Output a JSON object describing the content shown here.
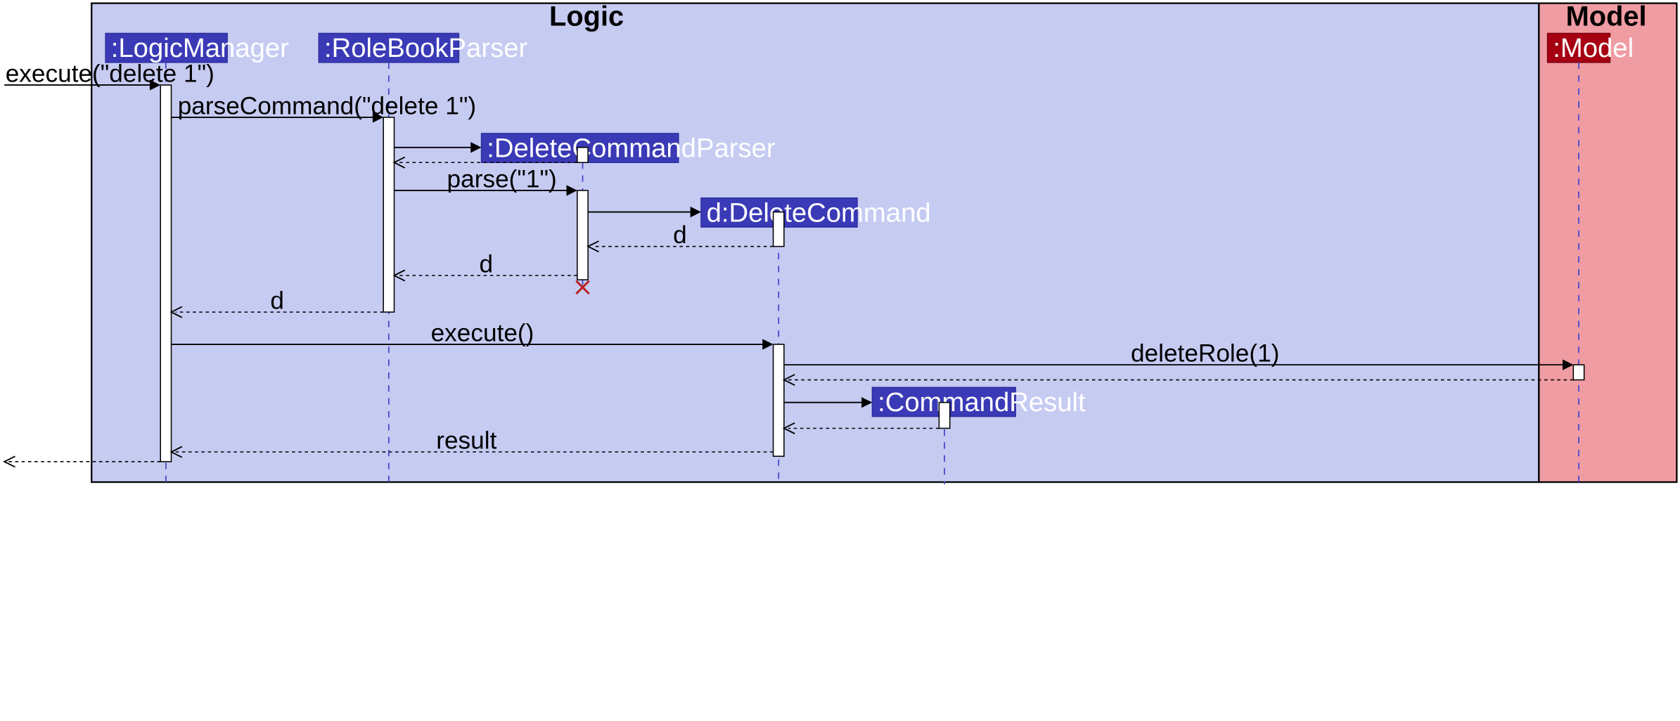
{
  "frames": {
    "logic": {
      "label": "Logic"
    },
    "model": {
      "label": "Model"
    }
  },
  "participants": {
    "logicManager": ":LogicManager",
    "roleBookParser": ":RoleBookParser",
    "deleteCommandParser": ":DeleteCommandParser",
    "deleteCommand": "d:DeleteCommand",
    "commandResult": ":CommandResult",
    "model": ":Model"
  },
  "messages": {
    "m1": "execute(\"delete 1\")",
    "m2": "parseCommand(\"delete 1\")",
    "m3": "parse(\"1\")",
    "m4": "d",
    "m5": "d",
    "m6": "d",
    "m7": "execute()",
    "m8": "deleteRole(1)",
    "m9": "result"
  }
}
